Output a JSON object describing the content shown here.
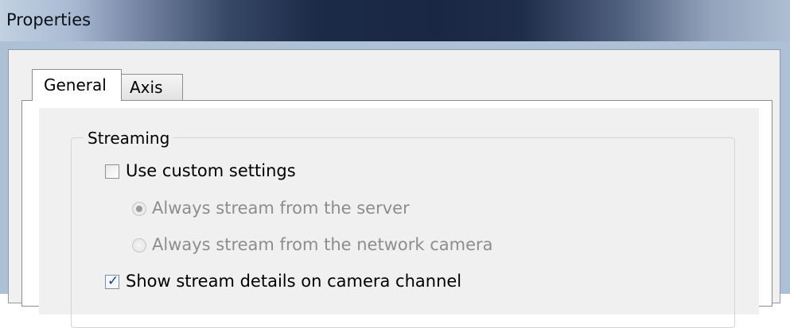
{
  "window": {
    "title": "Properties"
  },
  "tabs": [
    {
      "label": "General",
      "selected": true
    },
    {
      "label": "Axis",
      "selected": false
    }
  ],
  "streaming": {
    "group_label": "Streaming",
    "use_custom": {
      "label": "Use custom settings",
      "checked": false
    },
    "radio_server": {
      "label": "Always stream from the server",
      "selected": true,
      "enabled": false
    },
    "radio_camera": {
      "label": "Always stream from the network camera",
      "selected": false,
      "enabled": false
    },
    "show_details": {
      "label": "Show stream details on camera channel",
      "checked": true
    }
  }
}
